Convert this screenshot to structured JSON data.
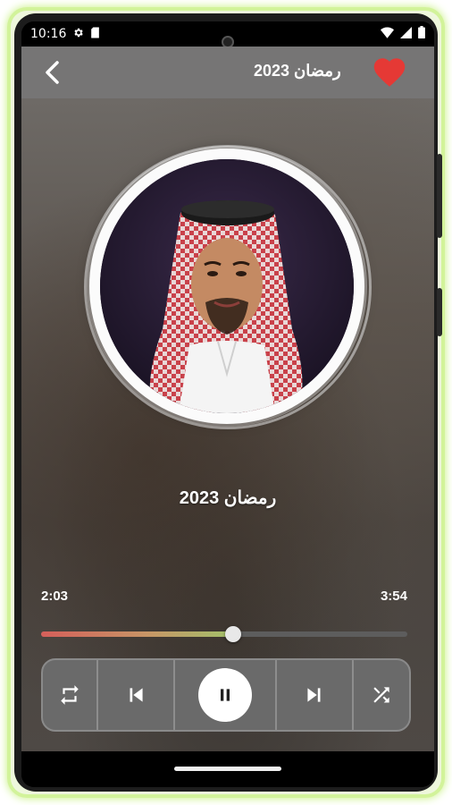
{
  "status_bar": {
    "time": "10:16",
    "icons": [
      "gear-icon",
      "sd-card-icon",
      "wifi-icon",
      "cell-signal-icon",
      "battery-icon"
    ]
  },
  "app_bar": {
    "title": "رمضان 2023",
    "back_icon": "chevron-left-icon",
    "favorite_icon": "heart-icon",
    "favorite_color": "#e53935"
  },
  "player": {
    "song_title": "رمضان 2023",
    "elapsed": "2:03",
    "duration": "3:54",
    "progress": 0.525,
    "is_playing": true
  },
  "controls": {
    "repeat_icon": "repeat-icon",
    "previous_icon": "skip-previous-icon",
    "play_pause_icon": "pause-icon",
    "next_icon": "skip-next-icon",
    "shuffle_icon": "shuffle-icon"
  },
  "colors": {
    "accent_start": "#d55f5a",
    "accent_end": "#a2c16a",
    "app_bar": "#767575",
    "device_glow": "#c5f07a"
  }
}
